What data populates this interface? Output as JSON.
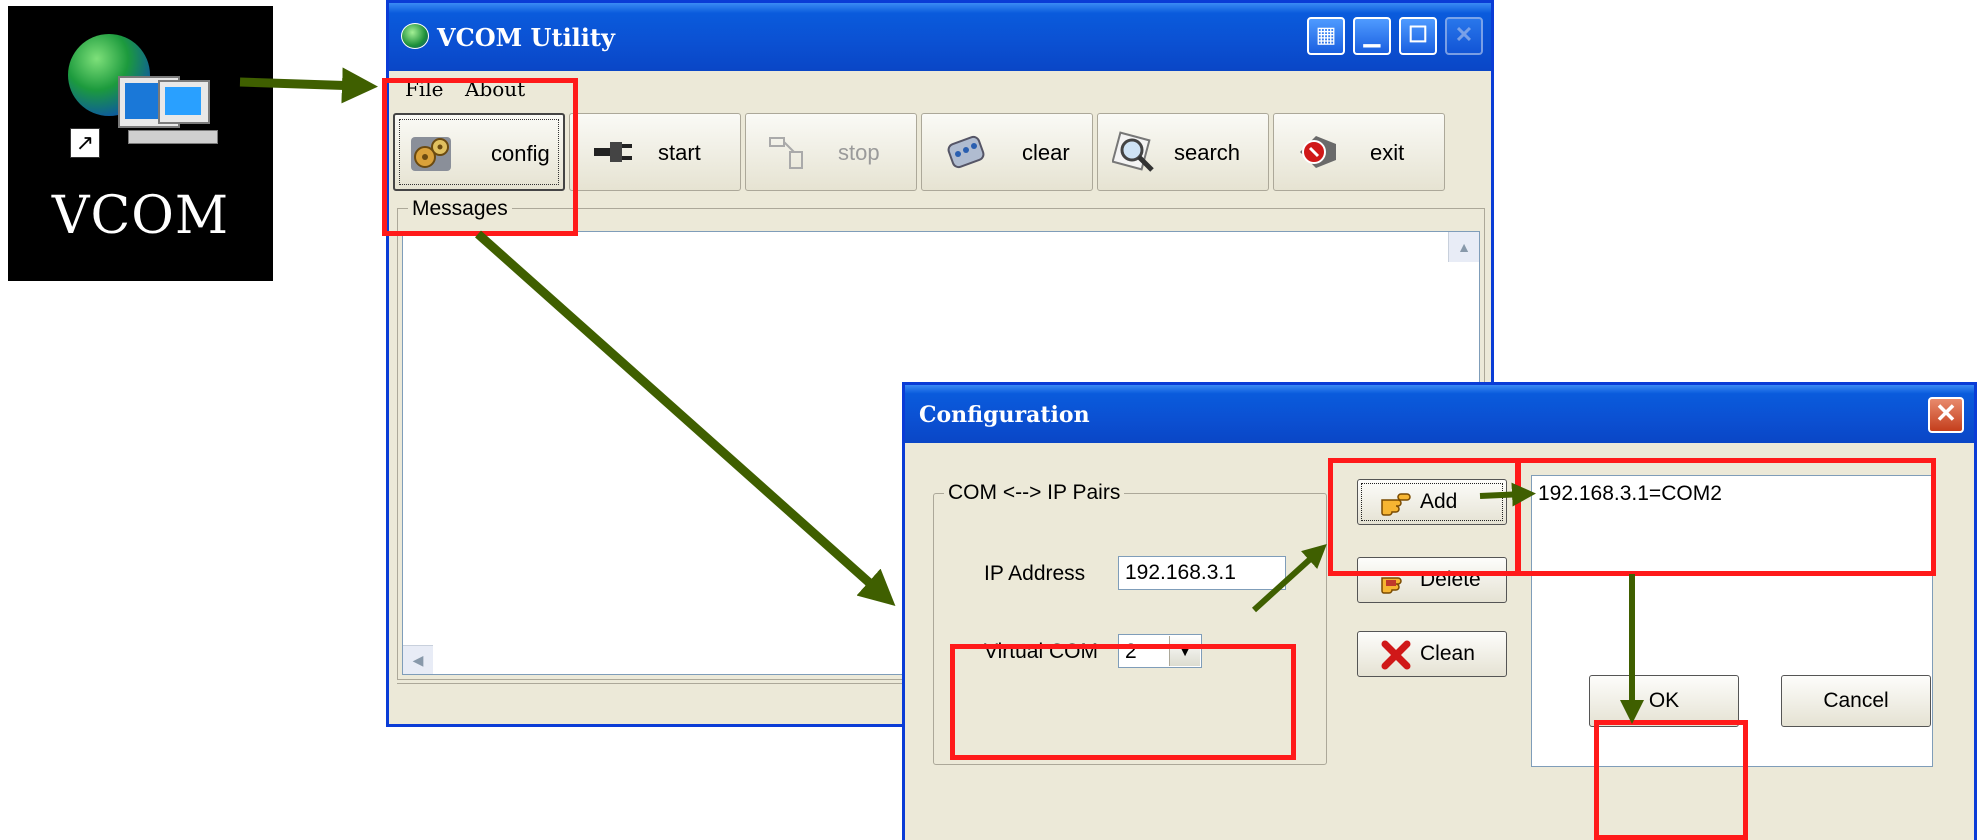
{
  "desktop_icon": {
    "label": "VCOM"
  },
  "vcom_window": {
    "title": "VCOM Utility",
    "menu": [
      "File",
      "About"
    ],
    "toolbar": [
      {
        "id": "config",
        "label": "config",
        "icon": "gears-icon"
      },
      {
        "id": "start",
        "label": "start",
        "icon": "plug-icon"
      },
      {
        "id": "stop",
        "label": "stop",
        "icon": "unplug-icon"
      },
      {
        "id": "clear",
        "label": "clear",
        "icon": "eraser-icon"
      },
      {
        "id": "search",
        "label": "search",
        "icon": "magnifier-icon"
      },
      {
        "id": "exit",
        "label": "exit",
        "icon": "exit-icon"
      }
    ],
    "messages_label": "Messages"
  },
  "config_dialog": {
    "title": "Configuration",
    "group_label": "COM <--> IP Pairs",
    "ip_label": "IP Address",
    "ip_value": "192.168.3.1",
    "vcom_label": "Virtual COM",
    "vcom_value": "2",
    "buttons": {
      "add": "Add",
      "delete": "Delete",
      "clean": "Clean",
      "ok": "OK",
      "cancel": "Cancel"
    },
    "pairs": [
      "192.168.3.1=COM2"
    ]
  },
  "colors": {
    "highlight": "#ff1a1a",
    "arrow": "#3f5f00",
    "titlebar": "#0b50d2",
    "face": "#ece9d8"
  }
}
